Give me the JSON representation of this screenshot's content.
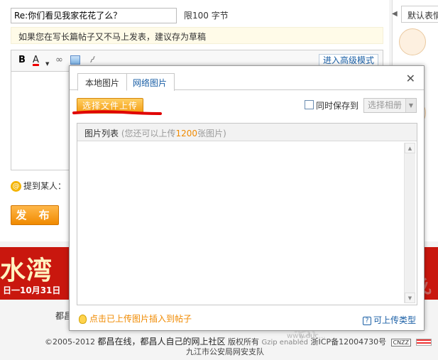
{
  "post": {
    "title_value": "Re:你们看见我家花花了么？",
    "title_limit": "限100 字节",
    "draft_tip": "如果您在写长篇帖子又不马上发表，建议存为草稿",
    "advanced_mode": "进入高级模式",
    "toolbar": {
      "bold": "B",
      "font_color": "A",
      "bold_icon": "bold-icon",
      "color_icon": "font-color-icon",
      "link_icon": "link-icon",
      "image_icon": "image-icon",
      "attach_icon": "attachment-icon"
    },
    "mention_label": "提到某人：",
    "publish": "发 布"
  },
  "emoticons": {
    "tab": "默认表情"
  },
  "banner": {
    "big_text": "水湾",
    "date_text": "日一10月31日"
  },
  "footer": {
    "cut_text": "都昌",
    "copyright": "©2005-2012",
    "site_text": "都昌在线，都昌人自己的网上社区",
    "rights": "版权所有",
    "gzip": "Gzip enabled",
    "icp": "浙ICP备12004730号",
    "cnzz": "CNZZ",
    "police": "九江市公安局网安支队",
    "watermark": "都昌在线",
    "watermark_url": "www.duc..."
  },
  "upload_dialog": {
    "tabs": [
      "本地图片",
      "网络图片"
    ],
    "active_tab": "本地图片",
    "close": "✕",
    "select_file": "选择文件上传",
    "sync_label": "同时保存到",
    "sync_checked": false,
    "album_placeholder": "选择相册",
    "list_title": "图片列表",
    "list_hint_prefix": "(您还可以上传",
    "list_remaining": "1200",
    "list_hint_suffix": "张图片)",
    "insert_tip": "点击已上传图片插入到帖子",
    "types_link": "可上传类型",
    "annotation_color": "#e00000",
    "accent_color": "#f39c12",
    "link_color": "#1a5fa6"
  }
}
